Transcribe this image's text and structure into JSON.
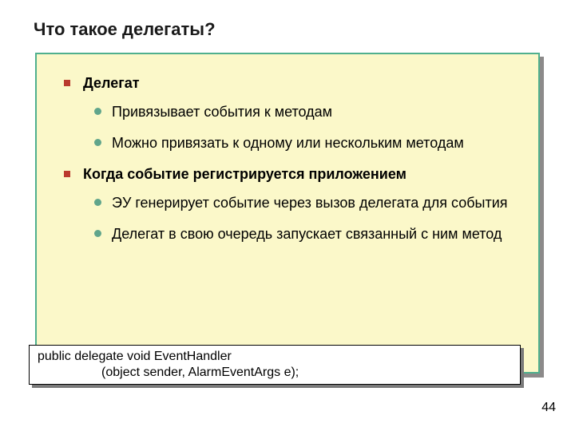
{
  "title": "Что такое делегаты?",
  "bullets": [
    {
      "text": "Делегат",
      "sub": [
        "Привязывает события к методам",
        "Можно привязать к одному или нескольким методам"
      ]
    },
    {
      "text": "Когда событие регистрируется приложением",
      "sub": [
        "ЭУ генерирует событие через  вызов делегата для события",
        "Делегат в свою очередь запускает связанный с ним метод"
      ]
    }
  ],
  "code": {
    "line1": "public delegate void EventHandler",
    "line2": "                  (object sender, AlarmEventArgs e);"
  },
  "page_number": "44"
}
